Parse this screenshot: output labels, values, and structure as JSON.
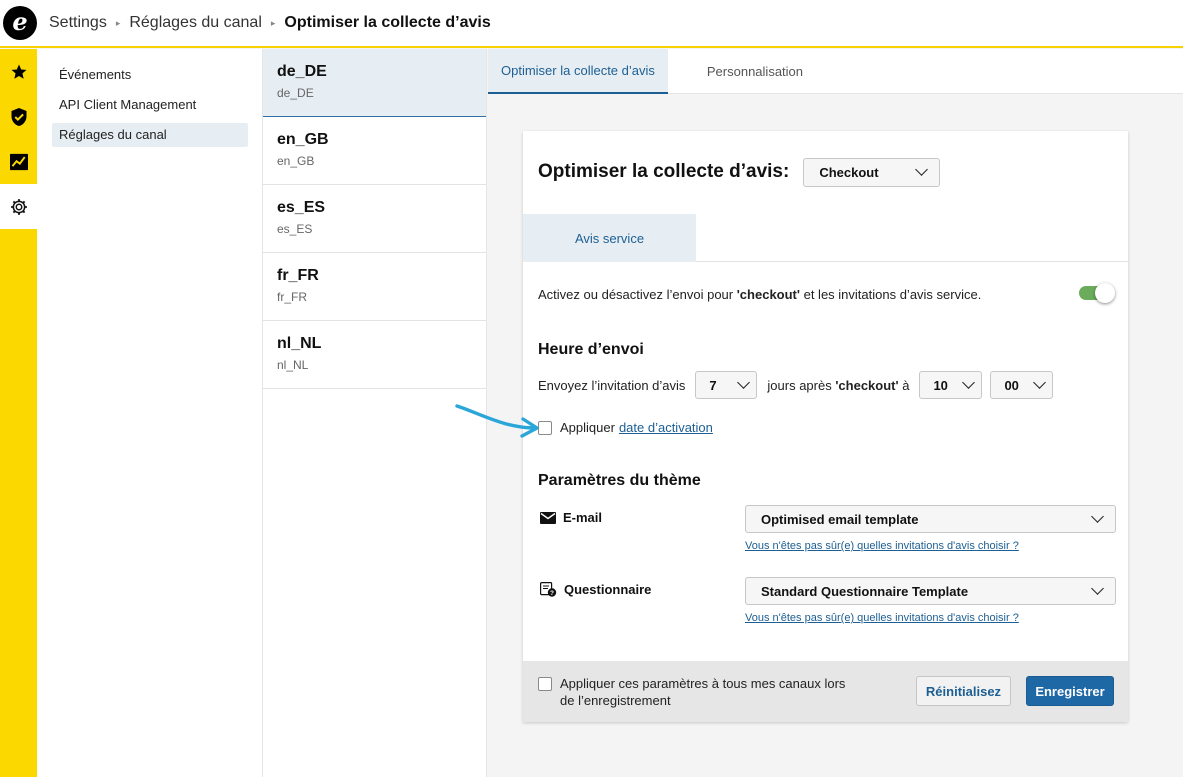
{
  "header": {
    "logo_letter": "e",
    "breadcrumb": [
      "Settings",
      "Réglages du canal",
      "Optimiser la collecte d’avis"
    ]
  },
  "rail": {
    "icons": [
      "star-icon",
      "shield-check-icon",
      "analytics-icon",
      "gear-icon"
    ],
    "active": "gear-icon",
    "color": "#fbd800"
  },
  "subnav": {
    "items": [
      "Événements",
      "API Client Management",
      "Réglages du canal"
    ],
    "active": "Réglages du canal"
  },
  "locales": [
    {
      "title": "de_DE",
      "sub": "de_DE"
    },
    {
      "title": "en_GB",
      "sub": "en_GB"
    },
    {
      "title": "es_ES",
      "sub": "es_ES"
    },
    {
      "title": "fr_FR",
      "sub": "fr_FR"
    },
    {
      "title": "nl_NL",
      "sub": "nl_NL"
    }
  ],
  "tabs": [
    "Optimiser la collecte d’avis",
    "Personnalisation"
  ],
  "card": {
    "title": "Optimiser la collecte d’avis:",
    "channel_select": "Checkout",
    "inner_tab": "Avis service",
    "toggle_text_before": "Activez ou désactivez l’envoi pour ",
    "toggle_text_bold": "'checkout'",
    "toggle_text_after": " et les invitations d’avis service.",
    "toggle_on": true,
    "send_time_title": "Heure d’envoi",
    "send_prefix": "Envoyez l’invitation d’avis",
    "days_value": "7",
    "send_middle_before": "jours après ",
    "send_middle_bold": "'checkout'",
    "send_middle_after": " à",
    "hour_value": "10",
    "minute_value": "00",
    "apply_label": "Appliquer",
    "apply_link": "date d’activation",
    "theme_title": "Paramètres du thème",
    "email_label": "E-mail",
    "email_select": "Optimised email template",
    "help_link": "Vous n'êtes pas sûr(e) quelles invitations d'avis choisir ?",
    "questionnaire_label": "Questionnaire",
    "questionnaire_select": "Standard Questionnaire Template",
    "footer_check": "Appliquer ces paramètres à tous mes canaux lors de l’enregistrement",
    "reset_button": "Réinitialisez",
    "save_button": "Enregistrer"
  },
  "colors": {
    "accent": "#1d5f93",
    "toggle": "#6aac5c",
    "arrow": "#2ba6d8"
  }
}
